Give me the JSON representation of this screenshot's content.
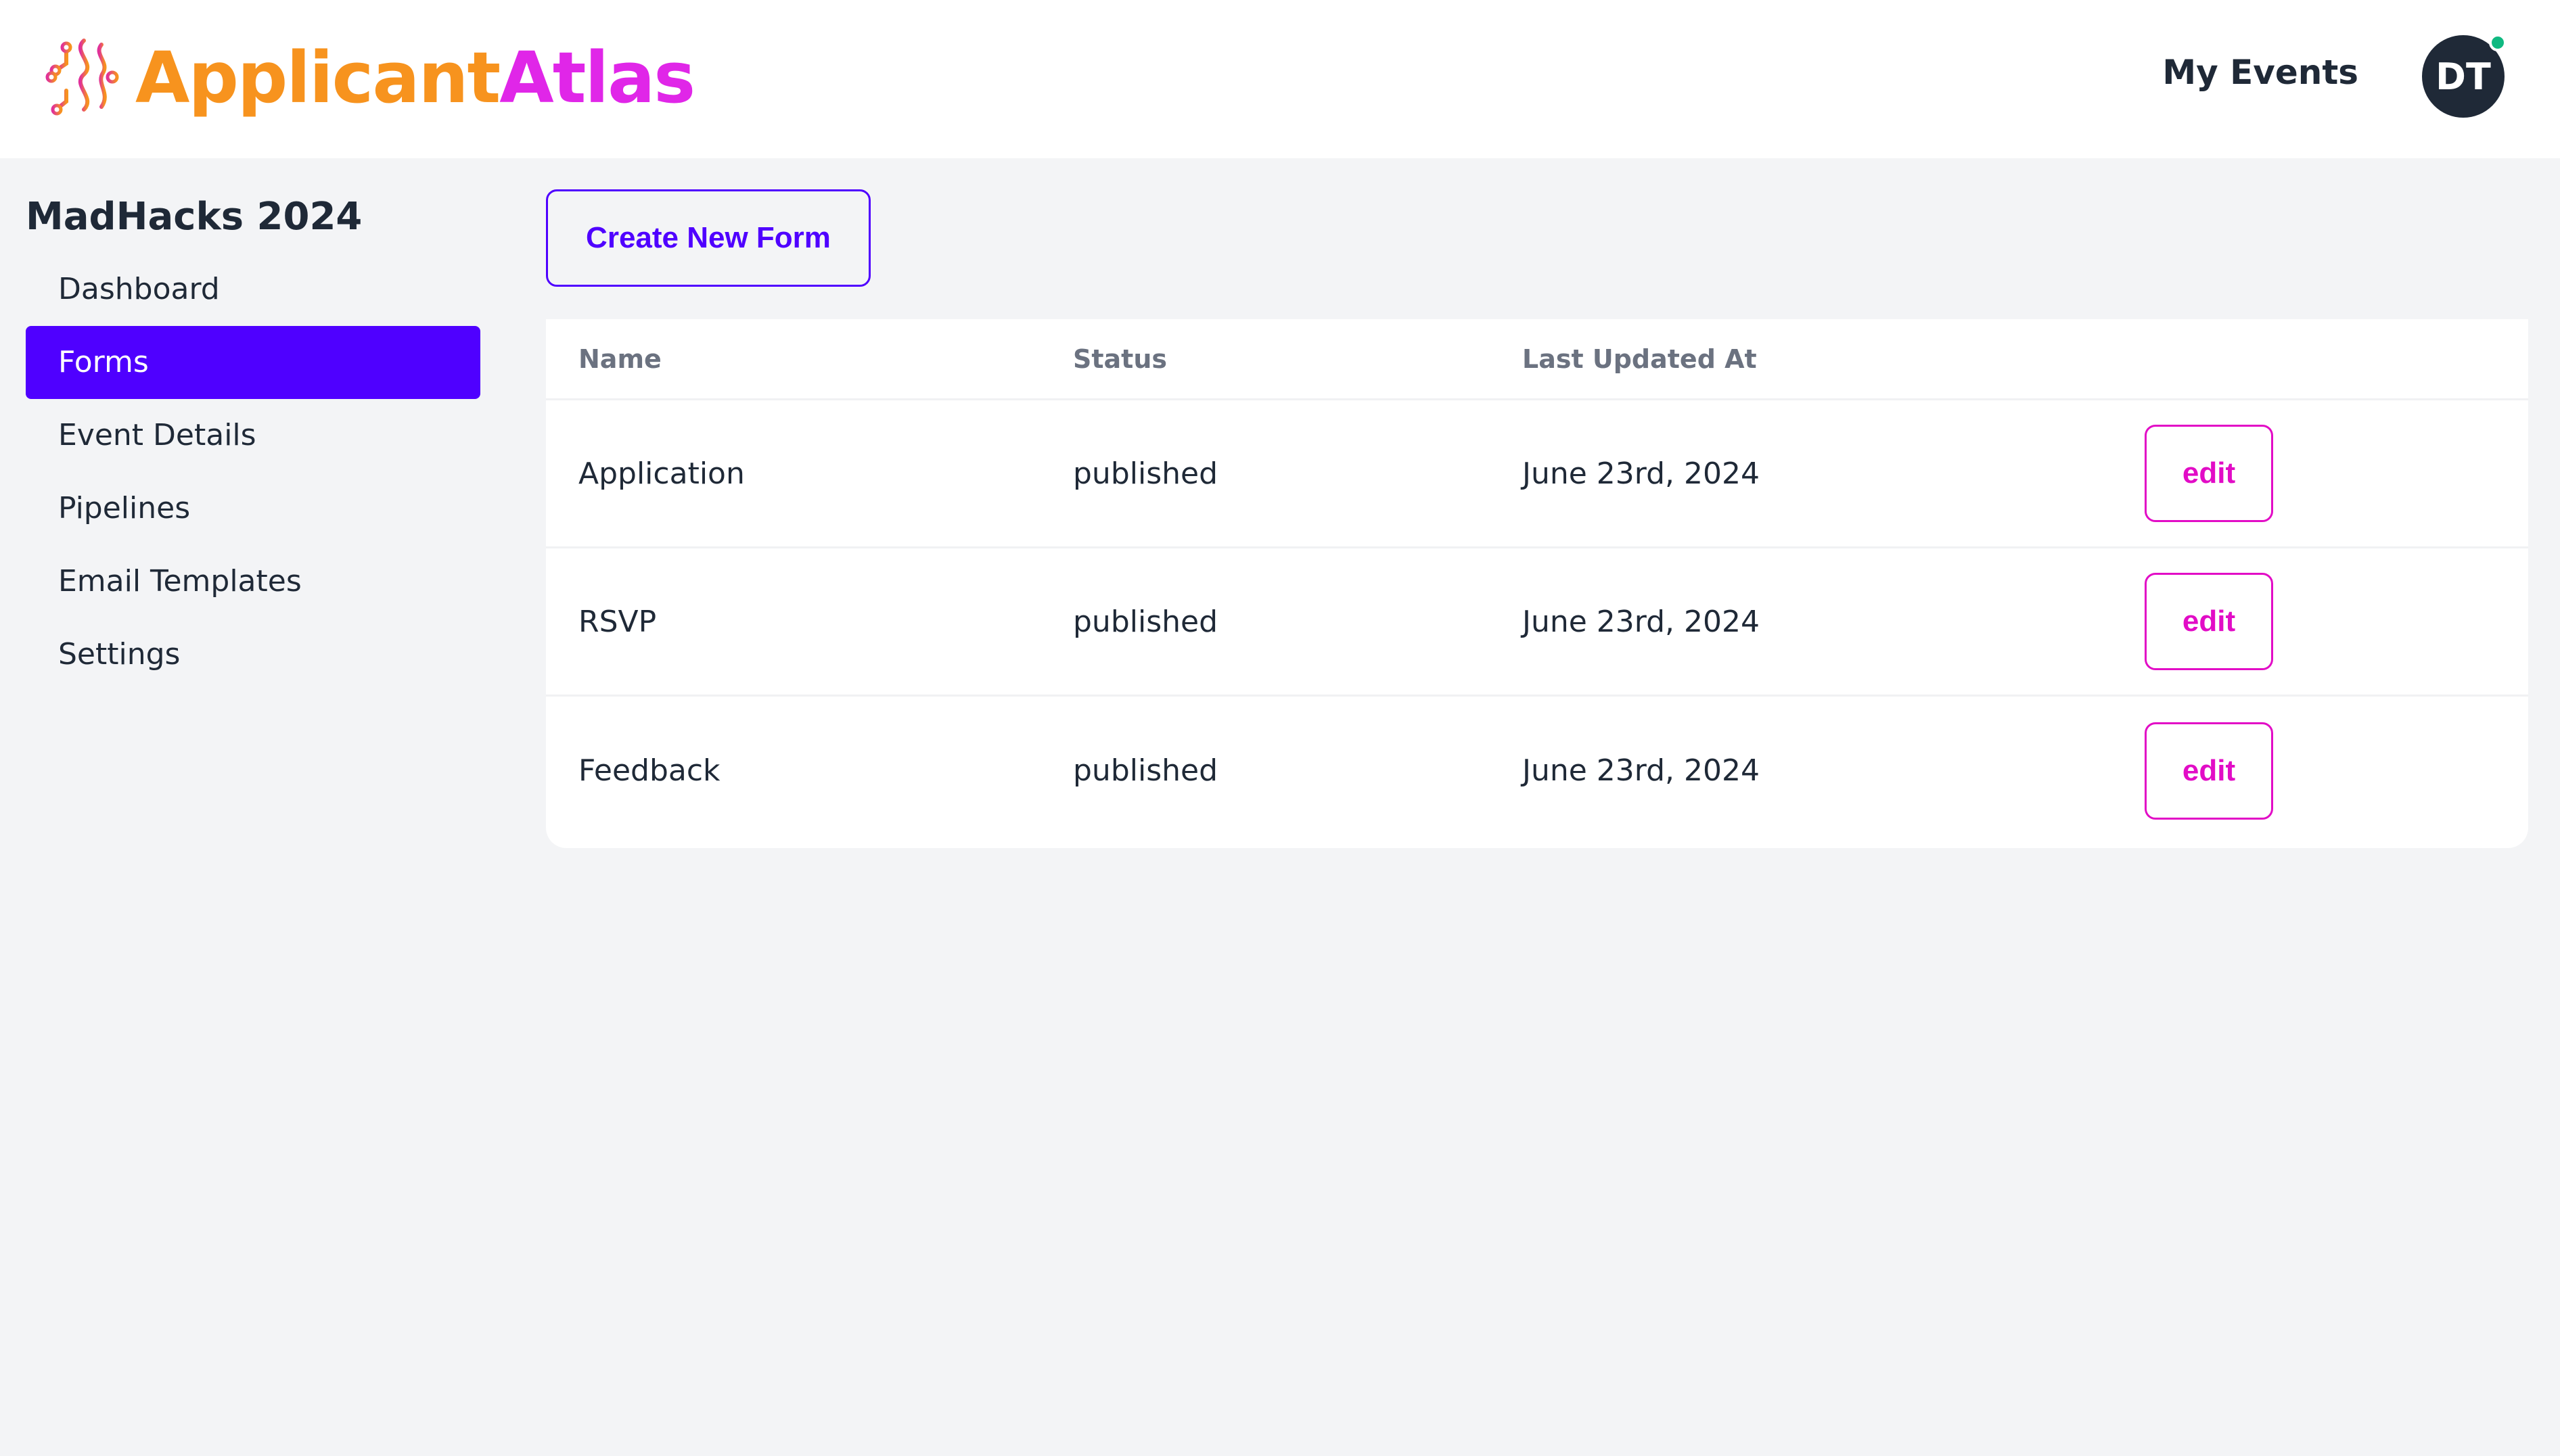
{
  "brand": {
    "part1": "Applicant",
    "part2": "Atlas",
    "colors": {
      "primary": "#f7931e",
      "secondary": "#e026e8"
    }
  },
  "header": {
    "my_events_label": "My Events",
    "avatar_initials": "DT",
    "avatar_status": "online"
  },
  "sidebar": {
    "event_name": "MadHacks 2024",
    "items": [
      {
        "label": "Dashboard",
        "active": false
      },
      {
        "label": "Forms",
        "active": true
      },
      {
        "label": "Event Details",
        "active": false
      },
      {
        "label": "Pipelines",
        "active": false
      },
      {
        "label": "Email Templates",
        "active": false
      },
      {
        "label": "Settings",
        "active": false
      }
    ]
  },
  "main": {
    "create_button_label": "Create New Form",
    "table": {
      "columns": [
        "Name",
        "Status",
        "Last Updated At",
        ""
      ],
      "rows": [
        {
          "name": "Application",
          "status": "published",
          "updated": "June 23rd, 2024",
          "action": "edit"
        },
        {
          "name": "RSVP",
          "status": "published",
          "updated": "June 23rd, 2024",
          "action": "edit"
        },
        {
          "name": "Feedback",
          "status": "published",
          "updated": "June 23rd, 2024",
          "action": "edit"
        }
      ]
    }
  },
  "colors": {
    "accent": "#4f00ff",
    "edit": "#e20cc6",
    "sidebar_bg": "#f3f4f6",
    "status_online": "#10b981"
  }
}
